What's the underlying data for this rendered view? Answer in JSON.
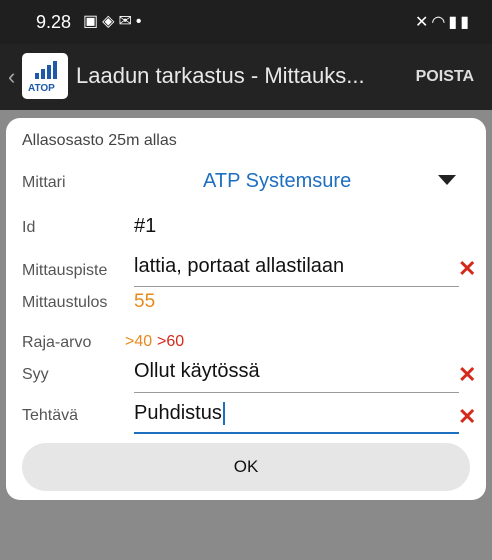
{
  "status_bar": {
    "time": "9.28",
    "left_icons": [
      "image-icon",
      "shield-icon",
      "mail-icon",
      "dot-icon"
    ],
    "right_icons": [
      "mute-icon",
      "wifi-icon",
      "signal-icon",
      "battery-icon"
    ]
  },
  "app_bar": {
    "logo_text": "ATOP",
    "title": "Laadun tarkastus - Mittauks...",
    "delete_label": "POISTA"
  },
  "dialog": {
    "heading": "Allasosasto 25m allas",
    "meter": {
      "label": "Mittari",
      "value": "ATP Systemsure"
    },
    "id": {
      "label": "Id",
      "value": "#1"
    },
    "point": {
      "label": "Mittauspiste",
      "value": "lattia, portaat allastilaan"
    },
    "result": {
      "label": "Mittaustulos",
      "value": "55",
      "color": "#e88a1a"
    },
    "limit": {
      "label": "Raja-arvo",
      "warn": ">40",
      "alarm": ">60",
      "warn_color": "#e88a1a",
      "alarm_color": "#d42a1c"
    },
    "reason": {
      "label": "Syy",
      "value": "Ollut käytössä"
    },
    "task": {
      "label": "Tehtävä",
      "value": "Puhdistus"
    },
    "ok_label": "OK"
  },
  "colors": {
    "accent": "#1e6fc0",
    "clear": "#d42a1c"
  }
}
